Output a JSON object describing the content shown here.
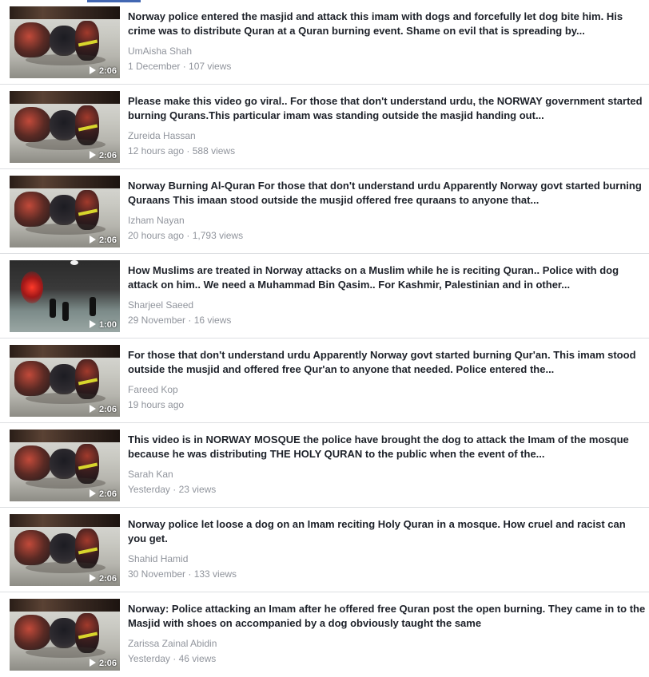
{
  "colors": {
    "title": "#1d2129",
    "secondary": "#90949c",
    "divider": "#dddfe2",
    "tab_accent": "#4267b2"
  },
  "videos": [
    {
      "title": "Norway police entered the masjid and attack this imam with dogs and forcefully let dog bite him. His crime was to distribute Quran at a Quran burning event. Shame on evil that is spreading by...",
      "author": "UmAisha Shah",
      "meta": "1 December · 107 views",
      "duration": "2:06"
    },
    {
      "title": "Please make this video go viral.. For those that don't understand urdu, the NORWAY government started burning Qurans.This particular imam was standing outside the masjid handing out...",
      "author": "Zureida Hassan",
      "meta": "12 hours ago · 588 views",
      "duration": "2:06"
    },
    {
      "title": "Norway Burning Al-Quran For those that don't understand urdu Apparently Norway govt started burning Quraans This imaan stood outside the musjid offered free quraans to anyone that...",
      "author": "Izham Nayan",
      "meta": "20 hours ago · 1,793 views",
      "duration": "2:06"
    },
    {
      "title": "How Muslims are treated in Norway attacks on a Muslim while he is reciting Quran.. Police with dog attack on him.. We need a Muhammad Bin Qasim.. For Kashmir, Palestinian and in other...",
      "author": "Sharjeel Saeed",
      "meta": "29 November · 16 views",
      "duration": "1:00"
    },
    {
      "title": "For those that don't understand urdu Apparently Norway govt started burning Qur'an. This imam stood outside the musjid and offered free Qur'an to anyone that needed. Police entered the...",
      "author": "Fareed Kop",
      "meta": "19 hours ago",
      "duration": "2:06"
    },
    {
      "title": "This video is in NORWAY MOSQUE the police have brought the dog to attack the Imam of the mosque because he was distributing THE HOLY QURAN to the public when the event of the...",
      "author": "Sarah Kan",
      "meta": "Yesterday · 23 views",
      "duration": "2:06"
    },
    {
      "title": "Norway police let loose a dog on an Imam reciting Holy Quran in a mosque. How cruel and racist can you get.",
      "author": "Shahid Hamid",
      "meta": "30 November · 133 views",
      "duration": "2:06"
    },
    {
      "title": "Norway: Police attacking an Imam after he offered free Quran post the open burning. They came in to the Masjid with shoes on accompanied by a dog obviously taught the same",
      "author": "Zarissa Zainal Abidin",
      "meta": "Yesterday · 46 views",
      "duration": "2:06"
    }
  ]
}
